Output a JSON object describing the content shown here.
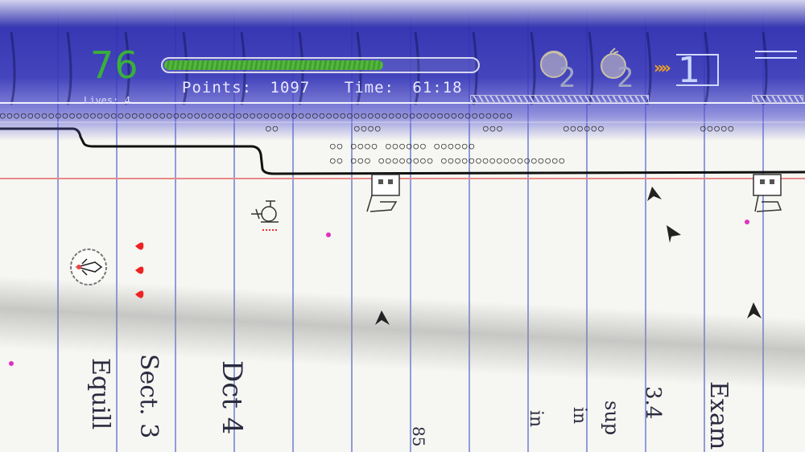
{
  "hud": {
    "score_value": "76",
    "lives_label": "Lives: 4",
    "health_fraction": 0.7,
    "points_label": "Points:",
    "points_value": "1097",
    "time_label": "Time:",
    "time_value": "61:18",
    "bomb_count": "2",
    "grenade_count": "2",
    "speed_level": "1",
    "speed_arrows": "»»"
  },
  "background_notes": {
    "line1": "Dct 4",
    "line2": "Sect. 3",
    "line3": "Equill",
    "line4": "Exam",
    "line5": "3.4",
    "line6": "sup",
    "line7": "in",
    "line8": "in",
    "line9": "85"
  },
  "colors": {
    "hud_blue": "#2b2ba8",
    "score_green": "#39b03a",
    "health_green": "#4caa34",
    "margin_red": "#e98a8a",
    "arrow_orange": "#f0a11e"
  }
}
